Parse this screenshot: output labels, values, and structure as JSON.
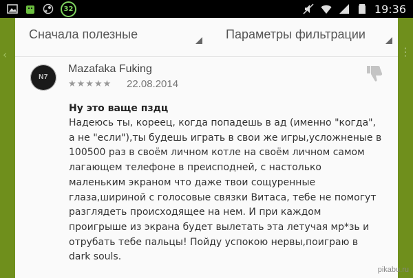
{
  "status_bar": {
    "icons_left": [
      "image-icon",
      "android-icon",
      "steam-icon"
    ],
    "badge": "32",
    "icons_right": [
      "mute-icon",
      "wifi-icon",
      "signal-icon",
      "battery-icon"
    ],
    "time": "19:36"
  },
  "filters": {
    "sort": "Сначала полезные",
    "params": "Параметры фильтрации"
  },
  "review": {
    "avatar_text": "N7",
    "author": "Mazafaka Fuking",
    "rating": 5,
    "stars": "★★★★★",
    "date": "22.08.2014",
    "title": "Ну это ваще пздц",
    "body": "Надеюсь ты, кореец, когда попадешь в ад (именно \"когда\",\nа не \"если\"),ты будешь играть в свои же игры,усложненые в\n100500 раз в своём личном котле на своём личном самом\nлагающем телефоне в преисподней, с настолько\nмаленьким экраном что даже твои сощуренные\nглаза,шириной с голосовые связки Витаса, тебе не помогут\nразглядеть происходящее на нем. И при каждом\nпроигрыше из экрана будет вылетать эта летучая мр*зь и\nотрубать тебе пальцы! Пойду успокою нервы,поиграю в\ndark souls."
  },
  "watermark": "pikabu.ru",
  "colors": {
    "app_bar": "#6f8f1c",
    "card": "#fafafa",
    "status_bar": "#000000",
    "badge": "#7fd35f"
  }
}
